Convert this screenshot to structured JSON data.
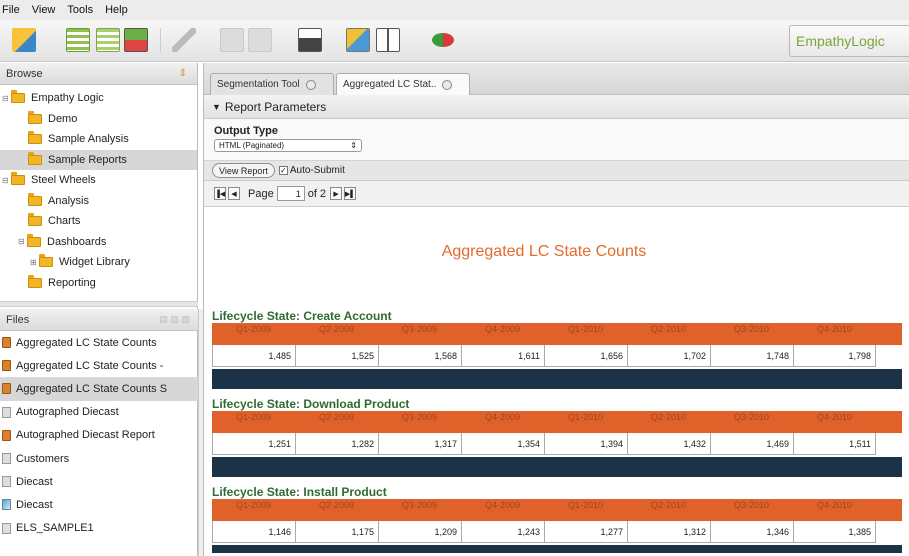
{
  "menu": [
    "File",
    "View",
    "Tools",
    "Help"
  ],
  "brand": "EmpathyLogic",
  "browse": {
    "header": "Browse",
    "tree": [
      {
        "label": "Empathy Logic",
        "level": 0,
        "expander": "⊟"
      },
      {
        "label": "Demo",
        "level": 1
      },
      {
        "label": "Sample Analysis",
        "level": 1
      },
      {
        "label": "Sample Reports",
        "level": 1,
        "selected": true
      },
      {
        "label": "Steel Wheels",
        "level": 0,
        "expander": "⊟"
      },
      {
        "label": "Analysis",
        "level": 1
      },
      {
        "label": "Charts",
        "level": 1
      },
      {
        "label": "Dashboards",
        "level": 1,
        "expander": "⊟"
      },
      {
        "label": "Widget Library",
        "level": 2,
        "expander": "⊞"
      },
      {
        "label": "Reporting",
        "level": 1
      }
    ]
  },
  "files": {
    "header": "Files",
    "items": [
      {
        "label": "Aggregated LC State Counts",
        "icon": "report-icon"
      },
      {
        "label": "Aggregated LC State Counts -",
        "icon": "report-icon"
      },
      {
        "label": "Aggregated LC State Counts S",
        "icon": "report-icon",
        "selected": true
      },
      {
        "label": "Autographed Diecast",
        "icon": "document-icon"
      },
      {
        "label": "Autographed Diecast Report",
        "icon": "report-icon"
      },
      {
        "label": "Customers",
        "icon": "document-icon"
      },
      {
        "label": "Diecast",
        "icon": "document-icon"
      },
      {
        "label": "Diecast",
        "icon": "analysis-icon"
      },
      {
        "label": "ELS_SAMPLE1",
        "icon": "document-icon"
      }
    ]
  },
  "tabs": [
    {
      "label": "Segmentation Tool"
    },
    {
      "label": "Aggregated LC Stat..",
      "active": true
    }
  ],
  "params": {
    "bar_label": "Report Parameters",
    "output_type_label": "Output Type",
    "output_type_value": "HTML (Paginated)",
    "view_report": "View Report",
    "auto_submit": "Auto-Submit"
  },
  "pager": {
    "page_label": "Page",
    "page_value": "1",
    "of_label": "of 2"
  },
  "report": {
    "title": "Aggregated LC State Counts",
    "quarters": [
      "Q1-2009",
      "Q2-2009",
      "Q3-2009",
      "Q4-2009",
      "Q1-2010",
      "Q2-2010",
      "Q3-2010",
      "Q4-2010"
    ],
    "sections": [
      {
        "title": "Lifecycle State: Create Account",
        "values": [
          "1,485",
          "1,525",
          "1,568",
          "1,611",
          "1,656",
          "1,702",
          "1,748",
          "1,798"
        ]
      },
      {
        "title": "Lifecycle State: Download Product",
        "values": [
          "1,251",
          "1,282",
          "1,317",
          "1,354",
          "1,394",
          "1,432",
          "1,469",
          "1,511"
        ]
      },
      {
        "title": "Lifecycle State: Install Product",
        "values": [
          "1,146",
          "1,175",
          "1,209",
          "1,243",
          "1,277",
          "1,312",
          "1,346",
          "1,385"
        ]
      }
    ]
  },
  "colors": {
    "accent_orange": "#e0622a",
    "title_orange": "#e36b2c",
    "section_green": "#2f6b2f",
    "dark_bar": "#1c3347",
    "brand_green": "#79a53a"
  }
}
